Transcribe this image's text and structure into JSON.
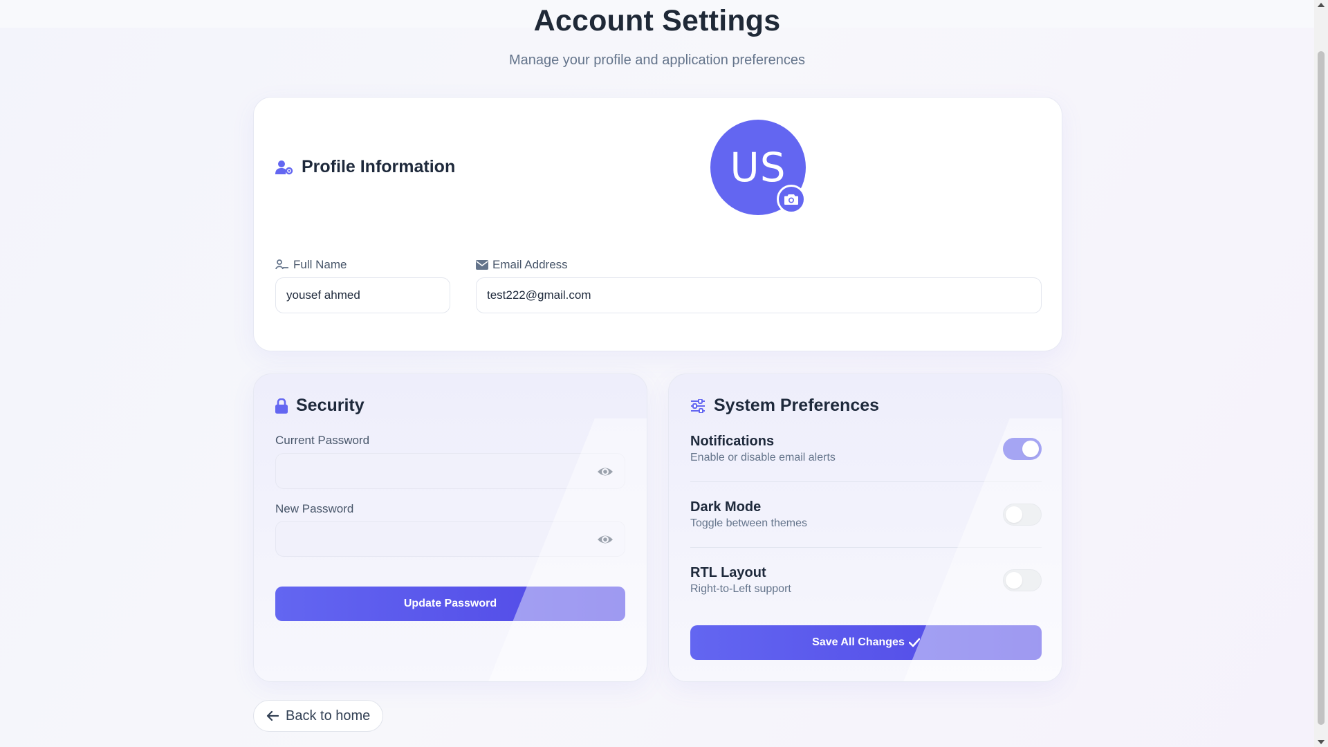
{
  "header": {
    "title": "Account Settings",
    "subtitle": "Manage your profile and application preferences"
  },
  "profile": {
    "heading": "Profile Information",
    "heading_icon": "user-gear-icon",
    "avatar_initials": "US",
    "avatar_icon": "camera-icon",
    "full_name_label": "Full Name",
    "full_name_value": "yousef ahmed",
    "email_label": "Email Address",
    "email_value": "test222@gmail.com"
  },
  "security": {
    "heading": "Security",
    "heading_icon": "lock-icon",
    "current_password_label": "Current Password",
    "current_password_value": "",
    "new_password_label": "New Password",
    "new_password_value": "",
    "update_button": "Update Password"
  },
  "preferences": {
    "heading": "System Preferences",
    "heading_icon": "sliders-icon",
    "items": [
      {
        "title": "Notifications",
        "description": "Enable or disable email alerts",
        "enabled": true
      },
      {
        "title": "Dark Mode",
        "description": "Toggle between themes",
        "enabled": false
      },
      {
        "title": "RTL Layout",
        "description": "Right-to-Left support",
        "enabled": false
      }
    ],
    "save_button": "Save All Changes"
  },
  "back_button": "Back to home",
  "colors": {
    "accent": "#6366f1",
    "accent_dark": "#4f46e5",
    "toggle_off": "#e2e5ea",
    "text_primary": "#1e293b",
    "text_muted": "#64748b"
  }
}
